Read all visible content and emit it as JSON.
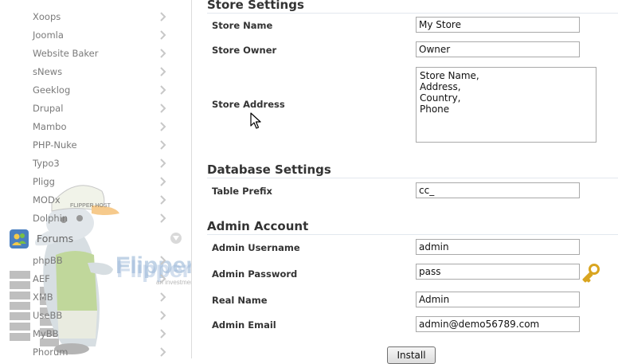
{
  "sidebar": {
    "items_top": [
      {
        "label": "Xoops"
      },
      {
        "label": "Joomla"
      },
      {
        "label": "Website Baker"
      },
      {
        "label": "sNews"
      },
      {
        "label": "Geeklog"
      },
      {
        "label": "Drupal"
      },
      {
        "label": "Mambo"
      },
      {
        "label": "PHP-Nuke"
      },
      {
        "label": "Typo3"
      },
      {
        "label": "Pligg"
      },
      {
        "label": "MODx"
      },
      {
        "label": "Dolphin"
      }
    ],
    "category": {
      "label": "Forums",
      "icon": "users-icon"
    },
    "items_forums": [
      {
        "label": "phpBB"
      },
      {
        "label": "AEF"
      },
      {
        "label": "XMB"
      },
      {
        "label": "UseBB"
      },
      {
        "label": "MyBB"
      },
      {
        "label": "Phorum"
      }
    ],
    "watermark": {
      "brand": "FlipperHost",
      "tagline": "an investment company",
      "cap_text": "FLIPPER HOST"
    }
  },
  "store_settings": {
    "title": "Store Settings",
    "store_name_label": "Store Name",
    "store_name_value": "My Store",
    "store_owner_label": "Store Owner",
    "store_owner_value": "Owner",
    "store_address_label": "Store Address",
    "store_address_value": "Store Name,\nAddress,\nCountry,\nPhone"
  },
  "database_settings": {
    "title": "Database Settings",
    "table_prefix_label": "Table Prefix",
    "table_prefix_value": "cc_"
  },
  "admin_account": {
    "title": "Admin Account",
    "username_label": "Admin Username",
    "username_value": "admin",
    "password_label": "Admin Password",
    "password_value": "pass",
    "real_name_label": "Real Name",
    "real_name_value": "Admin",
    "email_label": "Admin Email",
    "email_value": "admin@demo56789.com"
  },
  "install_label": "Install",
  "colors": {
    "accent_blue": "#3a8fc8",
    "chevron": "#c8c8c8",
    "key_gold": "#d9a520"
  }
}
